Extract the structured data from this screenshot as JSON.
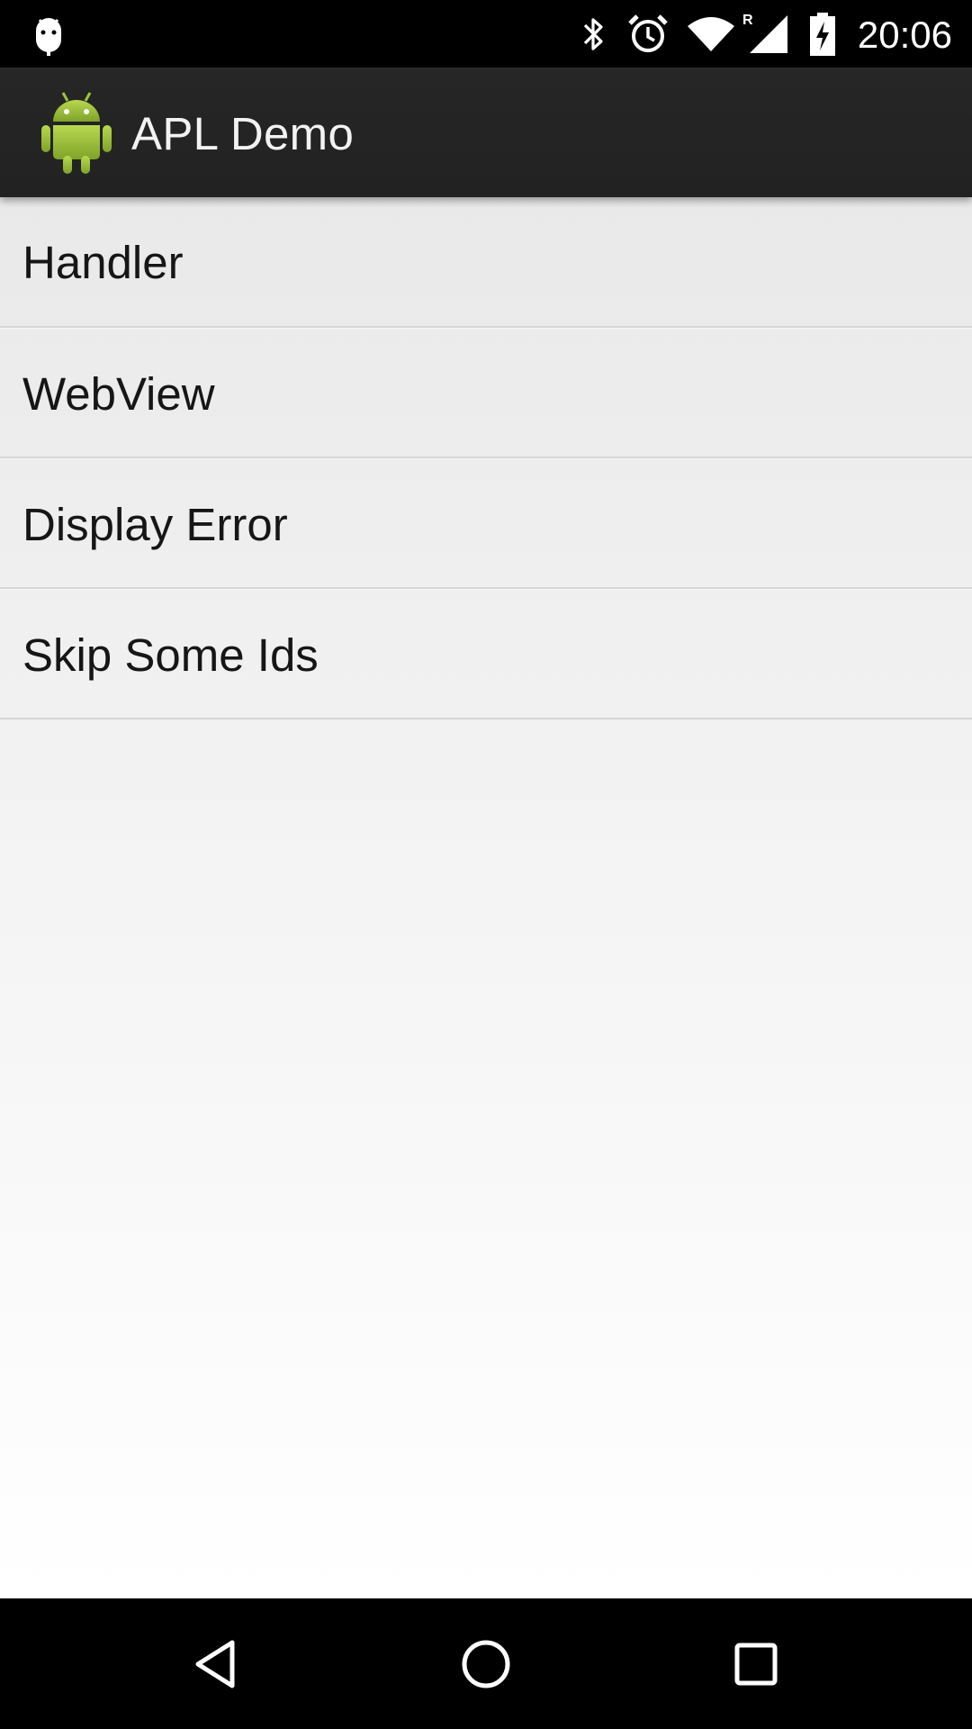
{
  "status_bar": {
    "time": "20:06",
    "icons": [
      "android-debug-icon",
      "bluetooth-icon",
      "alarm-icon",
      "wifi-icon",
      "roaming-signal-icon",
      "battery-charging-icon"
    ],
    "roaming_indicator": "R"
  },
  "action_bar": {
    "title": "APL Demo",
    "icon": "android-robot-icon"
  },
  "list": {
    "items": [
      {
        "label": "Handler"
      },
      {
        "label": "WebView"
      },
      {
        "label": "Display Error"
      },
      {
        "label": "Skip Some Ids"
      }
    ]
  },
  "nav_bar": {
    "buttons": [
      "back-icon",
      "home-icon",
      "recents-icon"
    ]
  },
  "colors": {
    "status_bar_bg": "#000000",
    "action_bar_bg": "#222222",
    "content_bg_top": "#e9e9e9",
    "content_bg_bottom": "#ffffff",
    "android_green": "#a4c639",
    "text": "#161616",
    "divider": "#d6d6d6"
  }
}
